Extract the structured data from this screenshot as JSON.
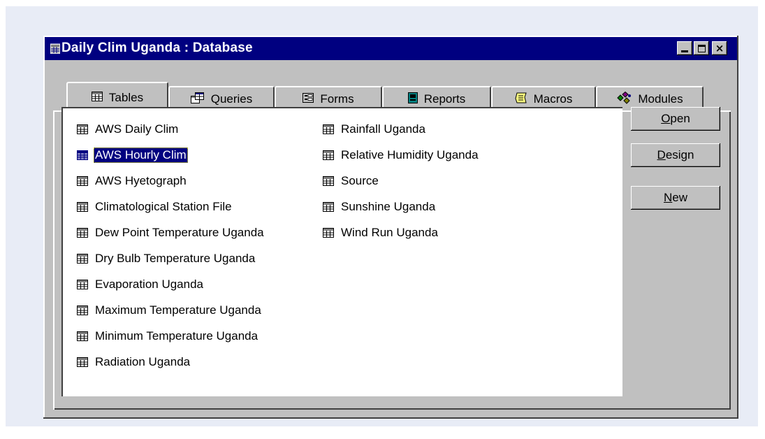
{
  "window": {
    "title": "Daily Clim Uganda : Database",
    "controls": {
      "minimize": "minimize",
      "maximize": "maximize",
      "close": "×"
    }
  },
  "tabs": [
    {
      "label": "Tables",
      "icon": "table-icon",
      "active": true
    },
    {
      "label": "Queries",
      "icon": "query-icon",
      "active": false
    },
    {
      "label": "Forms",
      "icon": "form-icon",
      "active": false
    },
    {
      "label": "Reports",
      "icon": "report-icon",
      "active": false
    },
    {
      "label": "Macros",
      "icon": "macro-icon",
      "active": false
    },
    {
      "label": "Modules",
      "icon": "module-icon",
      "active": false
    }
  ],
  "tables": {
    "column1": [
      {
        "label": "AWS Daily Clim"
      },
      {
        "label": "AWS Hourly Clim",
        "selected": true
      },
      {
        "label": "AWS Hyetograph"
      },
      {
        "label": "Climatological Station File"
      },
      {
        "label": "Dew Point Temperature Uganda"
      },
      {
        "label": "Dry Bulb Temperature Uganda"
      },
      {
        "label": "Evaporation Uganda"
      },
      {
        "label": "Maximum Temperature Uganda"
      },
      {
        "label": "Minimum Temperature Uganda"
      },
      {
        "label": "Radiation Uganda"
      }
    ],
    "column2": [
      {
        "label": "Rainfall Uganda"
      },
      {
        "label": "Relative Humidity Uganda"
      },
      {
        "label": "Source"
      },
      {
        "label": "Sunshine Uganda"
      },
      {
        "label": "Wind Run Uganda"
      }
    ]
  },
  "buttons": {
    "open": {
      "mnemonic": "O",
      "rest": "pen"
    },
    "design": {
      "mnemonic": "D",
      "rest": "esign"
    },
    "new": {
      "mnemonic": "N",
      "rest": "ew"
    }
  },
  "colors": {
    "titlebar": "#000080",
    "face": "#c0c0c0",
    "selection": "#000080",
    "backdrop": "#e8ecf6"
  }
}
